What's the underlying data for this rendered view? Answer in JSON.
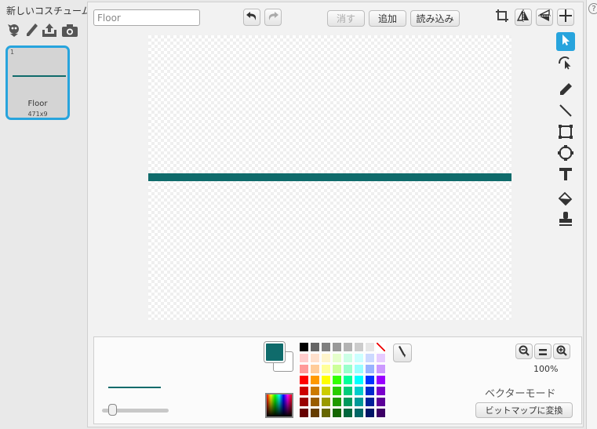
{
  "left_panel": {
    "title": "新しいコスチューム:",
    "new_costume_icons": [
      "choose-from-library-icon",
      "paint-new-icon",
      "upload-icon",
      "camera-icon"
    ],
    "costumes": [
      {
        "index": "1",
        "name": "Floor",
        "size": "471x9",
        "selected": true
      }
    ]
  },
  "editor": {
    "costume_name_value": "Floor",
    "costume_name_placeholder": "",
    "toolbar": {
      "clear_label": "消す",
      "add_label": "追加",
      "import_label": "読み込み"
    },
    "icons": [
      "undo-icon",
      "redo-icon",
      "crop-icon",
      "flip-horizontal-icon",
      "flip-vertical-icon",
      "set-center-icon"
    ],
    "tools": [
      {
        "name": "select-tool",
        "active": true
      },
      {
        "name": "reshape-tool",
        "active": false
      },
      {
        "name": "pencil-tool",
        "active": false
      },
      {
        "name": "line-tool",
        "active": false
      },
      {
        "name": "rectangle-tool",
        "active": false
      },
      {
        "name": "ellipse-tool",
        "active": false
      },
      {
        "name": "text-tool",
        "active": false
      },
      {
        "name": "fill-tool",
        "active": false
      },
      {
        "name": "stamp-tool",
        "active": false
      }
    ],
    "colors": {
      "foreground": "#0f6b6b",
      "background": "#ffffff",
      "accent": "#27a4dd"
    },
    "palette": [
      "#000000",
      "#666666",
      "#808080",
      "#999999",
      "#b3b3b3",
      "#cccccc",
      "#e6e6e6",
      "#ffffff",
      "#ffcccc",
      "#ffe0cc",
      "#fff5cc",
      "#e6ffcc",
      "#ccffe6",
      "#ccffff",
      "#ccd9ff",
      "#e6ccff",
      "#ff9999",
      "#ffcc99",
      "#ffff99",
      "#ccff99",
      "#99ffcc",
      "#99ffff",
      "#99b3ff",
      "#cc99ff",
      "#ff0000",
      "#ff9900",
      "#ffff00",
      "#33ff00",
      "#00ff99",
      "#00ffff",
      "#0033ff",
      "#9900ff",
      "#cc0000",
      "#cc7a00",
      "#cccc00",
      "#29cc00",
      "#00cc7a",
      "#00cccc",
      "#0029cc",
      "#7a00cc",
      "#990000",
      "#995c00",
      "#999900",
      "#1f9900",
      "#00995c",
      "#009999",
      "#001f99",
      "#5c0099",
      "#660000",
      "#663d00",
      "#666600",
      "#146600",
      "#00663d",
      "#006666",
      "#001466",
      "#3d0066"
    ],
    "zoom_level": "100%",
    "mode_label": "ベクターモード",
    "convert_label": "ビットマップに変換",
    "help_label": "?"
  }
}
